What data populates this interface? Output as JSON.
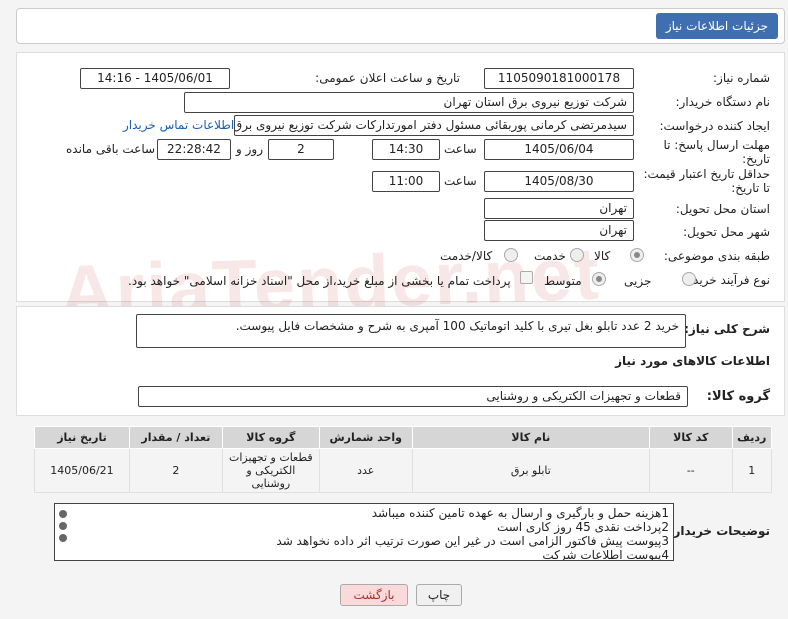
{
  "header": {
    "title": "جزئیات اطلاعات نیاز"
  },
  "form": {
    "need_number_label": "شماره نیاز:",
    "need_number": "1105090181000178",
    "announce_label": "تاریخ و ساعت اعلان عمومی:",
    "announce_value": "1405/06/01 - 14:16",
    "buyer_org_label": "نام دستگاه خریدار:",
    "buyer_org": "شرکت توزیع نیروی برق استان تهران",
    "requester_label": "ایجاد کننده درخواست:",
    "requester": "سیدمرتضی کرمانی پوربقائی مسئول دفتر امورتدارکات شرکت توزیع نیروی برق ا",
    "contact_link": "اطلاعات تماس خریدار",
    "reply_deadline_label": "مهلت ارسال پاسخ: تا تاریخ:",
    "reply_date": "1405/06/04",
    "time_label": "ساعت",
    "reply_time": "14:30",
    "days_value": "2",
    "days_label": "روز و",
    "remaining_value": "22:28:42",
    "remaining_label": "ساعت باقی مانده",
    "price_validity_label": "حداقل تاریخ اعتبار قیمت: تا تاریخ:",
    "price_date": "1405/08/30",
    "price_time": "11:00",
    "province_label": "استان محل تحویل:",
    "province": "تهران",
    "city_label": "شهر محل تحویل:",
    "city": "تهران",
    "category_label": "طبقه بندی موضوعی:",
    "category_options": [
      "کالا",
      "خدمت",
      "کالا/خدمت"
    ],
    "process_label": "نوع فرآیند خرید :",
    "process_options": [
      "جزیی",
      "متوسط"
    ],
    "payment_note": "پرداخت تمام یا بخشی از مبلغ خرید،از محل \"اسناد خزانه اسلامی\" خواهد بود."
  },
  "description": {
    "label": "شرح کلی نیاز:",
    "value": "خرید 2 عدد تابلو بغل تیری با کلید اتوماتیک 100 آمپری به شرح و مشخصات فایل پیوست."
  },
  "goods": {
    "section_title": "اطلاعات کالاهای مورد نیاز",
    "group_label": "گروه کالا:",
    "group_value": "قطعات و تجهیزات الکتریکی و روشنایی",
    "columns": [
      "ردیف",
      "کد کالا",
      "نام کالا",
      "واحد شمارش",
      "گروه کالا",
      "تعداد / مقدار",
      "تاریخ نیاز"
    ],
    "rows": [
      {
        "row": "1",
        "code": "--",
        "name": "تابلو برق",
        "unit": "عدد",
        "group": "قطعات و تجهیزات الکتریکی و روشنایی",
        "qty": "2",
        "date": "1405/06/21"
      }
    ]
  },
  "buyer_notes": {
    "label": "توضیحات خریدار:",
    "lines": [
      "1هزینه حمل و بارگیری و ارسال به عهده تامین کننده میباشد",
      "2پرداخت نقدی 45 روز کاری است",
      "3پیوست پیش فاکتور الزامی است در غیر این صورت ترتیب اثر داده نخواهد شد",
      "4پیوست اطلاعات شرکت"
    ]
  },
  "buttons": {
    "print": "چاپ",
    "back": "بازگشت"
  },
  "watermark": "AriaTender.net"
}
